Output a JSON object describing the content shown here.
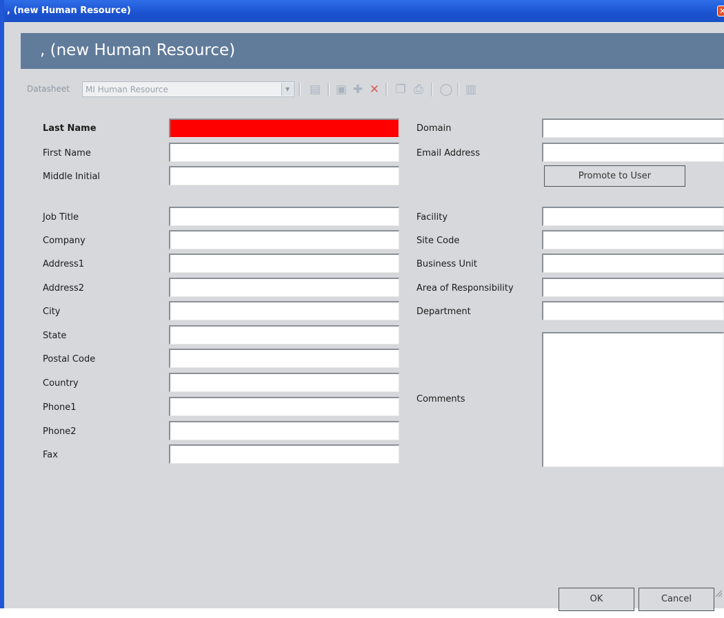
{
  "window": {
    "title": ", (new Human Resource)",
    "close_icon": "close-icon"
  },
  "header": {
    "title": ", (new Human Resource)"
  },
  "toolbar": {
    "datasheet_label": "Datasheet",
    "datasheet_value": "MI Human Resource",
    "icons": [
      "open-icon",
      "save-icon",
      "save-new-icon",
      "delete-icon",
      "copy-icon",
      "print-icon",
      "search-icon",
      "report-icon"
    ]
  },
  "left_fields": [
    {
      "label": "Last Name",
      "value": "",
      "required": true
    },
    {
      "label": "First Name",
      "value": ""
    },
    {
      "label": "Middle Initial",
      "value": ""
    },
    {
      "label": "Job Title",
      "value": ""
    },
    {
      "label": "Company",
      "value": ""
    },
    {
      "label": "Address1",
      "value": ""
    },
    {
      "label": "Address2",
      "value": ""
    },
    {
      "label": "City",
      "value": ""
    },
    {
      "label": "State",
      "value": ""
    },
    {
      "label": "Postal Code",
      "value": ""
    },
    {
      "label": "Country",
      "value": ""
    },
    {
      "label": "Phone1",
      "value": ""
    },
    {
      "label": "Phone2",
      "value": ""
    },
    {
      "label": "Fax",
      "value": ""
    }
  ],
  "right_fields": [
    {
      "label": "Domain",
      "value": ""
    },
    {
      "label": "Email Address",
      "value": ""
    },
    {
      "label": "Facility",
      "value": ""
    },
    {
      "label": "Site Code",
      "value": ""
    },
    {
      "label": "Business Unit",
      "value": ""
    },
    {
      "label": "Area of Responsibility",
      "value": ""
    },
    {
      "label": "Department",
      "value": ""
    },
    {
      "label": "Comments",
      "value": ""
    }
  ],
  "promote_button": "Promote to User",
  "footer": {
    "ok": "OK",
    "cancel": "Cancel"
  },
  "colors": {
    "required_field": "#ff0000",
    "header_band": "#617b9a",
    "titlebar": "#1b52cf"
  }
}
